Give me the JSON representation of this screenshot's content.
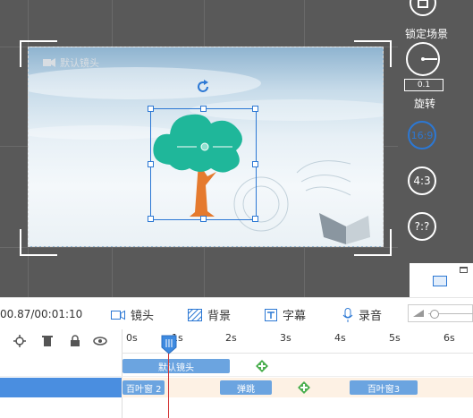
{
  "stage": {
    "camera_label": "默认镜头",
    "lock_label": "锁定场景",
    "rotate_label": "旋转",
    "rotate_value": "0.1",
    "ratio_16_9": "16:9",
    "ratio_4_3": "4:3",
    "ratio_custom": "?:?"
  },
  "toolbar": {
    "time": "00.87/00:01:10",
    "camera": "镜头",
    "background": "背景",
    "caption": "字幕",
    "record": "录音"
  },
  "timeline": {
    "ticks": [
      "0s",
      "1s",
      "2s",
      "3s",
      "4s",
      "5s",
      "6s"
    ],
    "camera_track": {
      "clip": "默认镜头"
    },
    "effects_track": {
      "clips": [
        "百叶窗 2",
        "弹跳",
        "百叶窗3"
      ]
    }
  },
  "colors": {
    "accent": "#2c78d4",
    "track_highlight": "#4a8ee0",
    "playhead": "#d33333",
    "tree_leaves": "#1fb79a",
    "tree_trunk": "#e57a2e"
  }
}
